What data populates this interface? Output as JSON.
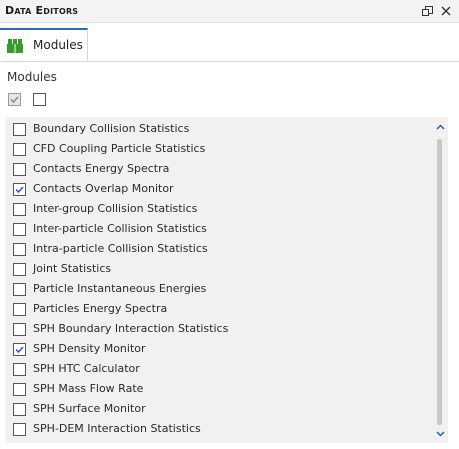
{
  "panel": {
    "title": "Data Editors",
    "tab_label": "Modules"
  },
  "section": {
    "label": "Modules"
  },
  "colors": {
    "accent": "#2b6cb0",
    "tab_icon": "#3a9a2e",
    "list_background": "#f1f1f1"
  },
  "modules": [
    {
      "label": "Boundary Collision Statistics",
      "checked": false
    },
    {
      "label": "CFD Coupling Particle Statistics",
      "checked": false
    },
    {
      "label": "Contacts Energy Spectra",
      "checked": false
    },
    {
      "label": "Contacts Overlap Monitor",
      "checked": true
    },
    {
      "label": "Inter-group Collision Statistics",
      "checked": false
    },
    {
      "label": "Inter-particle Collision Statistics",
      "checked": false
    },
    {
      "label": "Intra-particle Collision Statistics",
      "checked": false
    },
    {
      "label": "Joint Statistics",
      "checked": false
    },
    {
      "label": "Particle Instantaneous Energies",
      "checked": false
    },
    {
      "label": "Particles Energy Spectra",
      "checked": false
    },
    {
      "label": "SPH Boundary Interaction Statistics",
      "checked": false
    },
    {
      "label": "SPH Density Monitor",
      "checked": true
    },
    {
      "label": "SPH HTC Calculator",
      "checked": false
    },
    {
      "label": "SPH Mass Flow Rate",
      "checked": false
    },
    {
      "label": "SPH Surface Monitor",
      "checked": false
    },
    {
      "label": "SPH-DEM Interaction Statistics",
      "checked": false
    }
  ]
}
